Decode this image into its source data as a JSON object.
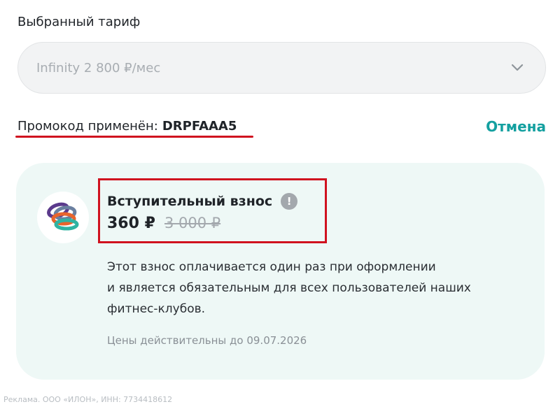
{
  "tariff": {
    "label": "Выбранный тариф",
    "selected_value": "Infinity 2 800 ₽/мес"
  },
  "promo": {
    "label": "Промокод применён:",
    "code": "DRPFAAA5",
    "cancel_label": "Отмена"
  },
  "fee": {
    "title": "Вступительный взнос",
    "info_glyph": "!",
    "price_new": "360 ₽",
    "price_old": "3 000 ₽",
    "description_lines": [
      "Этот взнос оплачивается один раз при оформлении",
      "и является обязательным для всех пользователей наших",
      "фитнес-клубов."
    ],
    "validity": "Цены действительны до 09.07.2026"
  },
  "footer": {
    "ad_text": "Реклама. ООО «ИЛОН», ИНН: 7734418612"
  },
  "colors": {
    "accent": "#14a0a0",
    "highlight": "#d0121f",
    "card_bg": "#eef8f6"
  },
  "icons": {
    "dropdown": "chevron-down-icon",
    "info": "info-icon",
    "avatar": "fitness-bracelets-icon"
  }
}
